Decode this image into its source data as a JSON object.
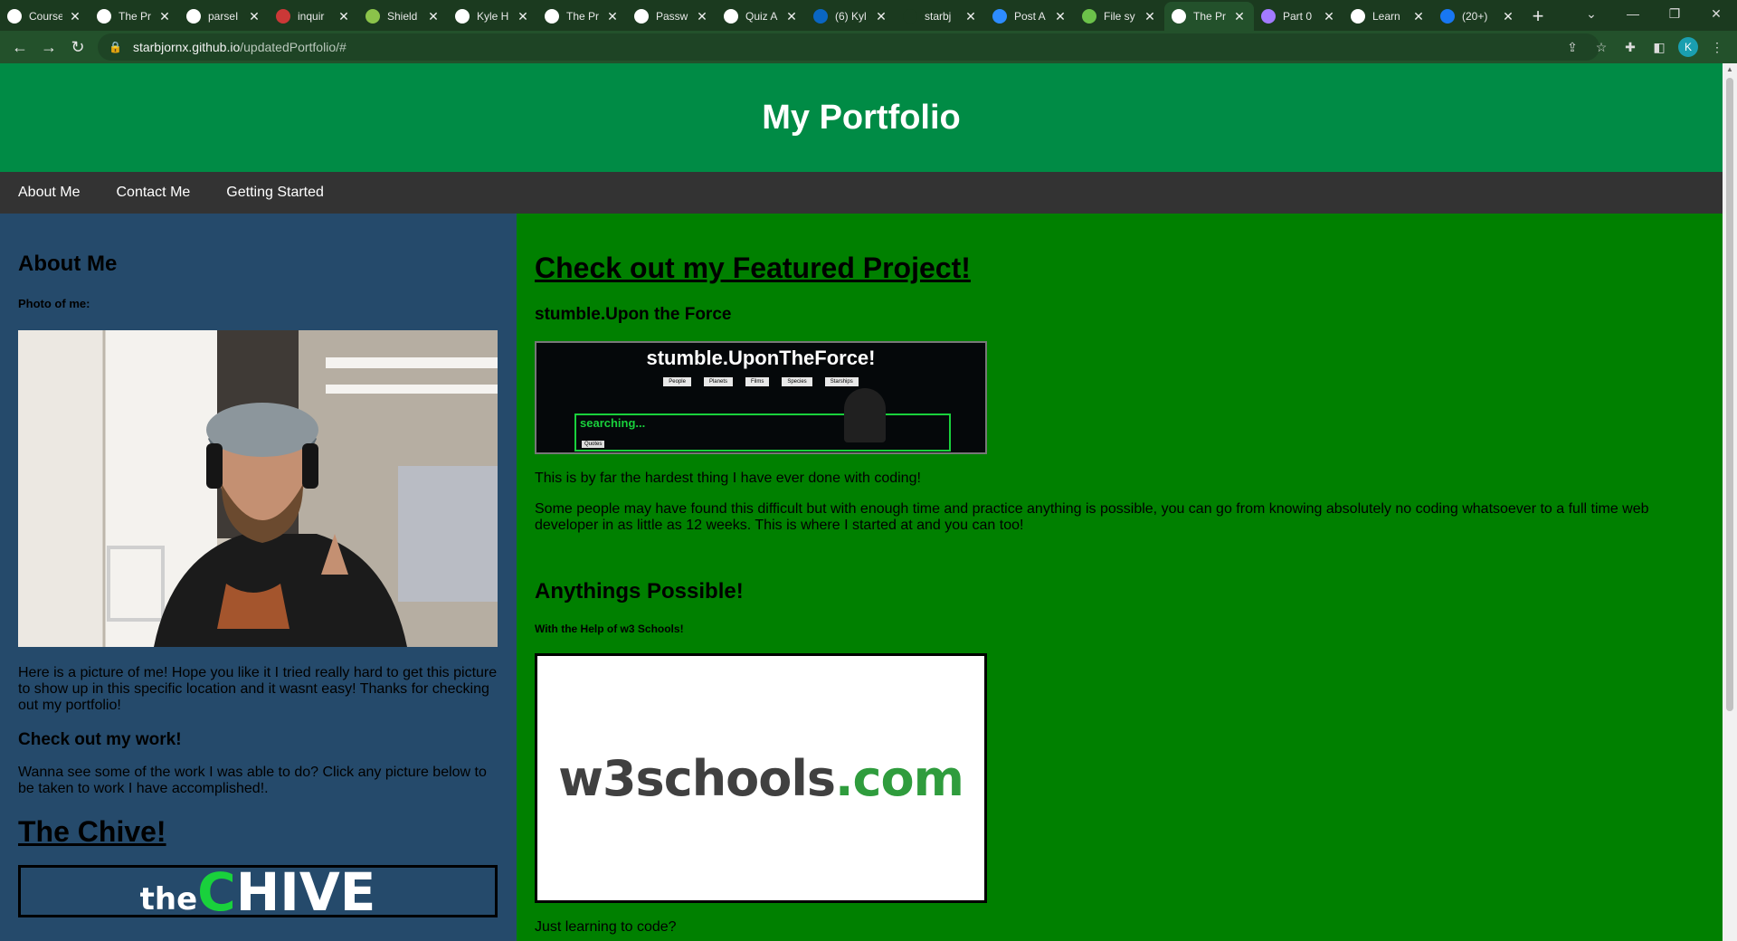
{
  "browser": {
    "tabs": [
      {
        "label": "Course",
        "icon": "github-icon",
        "color": "#ffffff"
      },
      {
        "label": "The Pr",
        "icon": "github-icon",
        "color": "#ffffff"
      },
      {
        "label": "parseI",
        "icon": "medium-icon",
        "color": "#ffffff"
      },
      {
        "label": "inquir",
        "icon": "npm-icon",
        "color": "#cb3837"
      },
      {
        "label": "Shield",
        "icon": "shield-icon",
        "color": "#8bc34a"
      },
      {
        "label": "Kyle H",
        "icon": "github-icon",
        "color": "#ffffff"
      },
      {
        "label": "The Pr",
        "icon": "github-icon",
        "color": "#ffffff"
      },
      {
        "label": "Passw",
        "icon": "github-icon",
        "color": "#ffffff"
      },
      {
        "label": "Quiz A",
        "icon": "github-icon",
        "color": "#ffffff"
      },
      {
        "label": "(6) Kyl",
        "icon": "linkedin-icon",
        "color": "#0a66c2"
      },
      {
        "label": "starbj",
        "icon": "github-icon",
        "color": "#1b3a1f"
      },
      {
        "label": "Post A",
        "icon": "zoom-icon",
        "color": "#2d8cff"
      },
      {
        "label": "File sy",
        "icon": "node-icon",
        "color": "#6cc24a"
      },
      {
        "label": "The Pr",
        "icon": "github-icon",
        "color": "#ffffff",
        "active": true
      },
      {
        "label": "Part 0",
        "icon": "apollo-icon",
        "color": "#a37bff"
      },
      {
        "label": "Learn",
        "icon": "angular-icon",
        "color": "#ffffff"
      },
      {
        "label": "(20+)",
        "icon": "facebook-icon",
        "color": "#1877f2"
      }
    ],
    "url_host": "starbjornx.github.io",
    "url_path": "/updatedPortfolio/#",
    "profile_initial": "K"
  },
  "site": {
    "title": "My Portfolio",
    "nav": [
      "About Me",
      "Contact Me",
      "Getting Started"
    ]
  },
  "left": {
    "heading": "About Me",
    "photo_label": "Photo of me:",
    "photo_caption": "Here is a picture of me! Hope you like it I tried really hard to get this picture to show up in this specific location and it wasnt easy! Thanks for checking out my portfolio!",
    "work_heading": "Check out my work!",
    "work_text": "Wanna see some of the work I was able to do? Click any picture below to be taken to work I have accomplished!.",
    "chive_link": "The Chive!",
    "chive_logo_the": "the",
    "chive_logo_c": "C",
    "chive_logo_hive": "HIVE"
  },
  "right": {
    "featured_link": "Check out my Featured Project!",
    "project_name": "stumble.Upon the Force",
    "screenshot": {
      "title": "stumble.UponTheForce!",
      "buttons": [
        "People",
        "Planets",
        "Films",
        "Species",
        "Starships"
      ],
      "search_text": "searching...",
      "small_button": "Quotes"
    },
    "p1": "This is by far the hardest thing I have ever done with coding!",
    "p2": "Some people may have found this difficult but with enough time and practice anything is possible, you can go from knowing absolutely no coding whatsoever to a full time web developer in as little as 12 weeks. This is where I started at and you can too!",
    "anything_heading": "Anythings Possible!",
    "w3_caption": "With the Help of w3 Schools!",
    "w3_logo_main": "w3schools",
    "w3_logo_tld": ".com",
    "footer_text": "Just learning to code?"
  },
  "colors": {
    "header": "#008b45",
    "nav": "#333333",
    "left_bg": "#254a6b",
    "right_bg": "#008000"
  }
}
